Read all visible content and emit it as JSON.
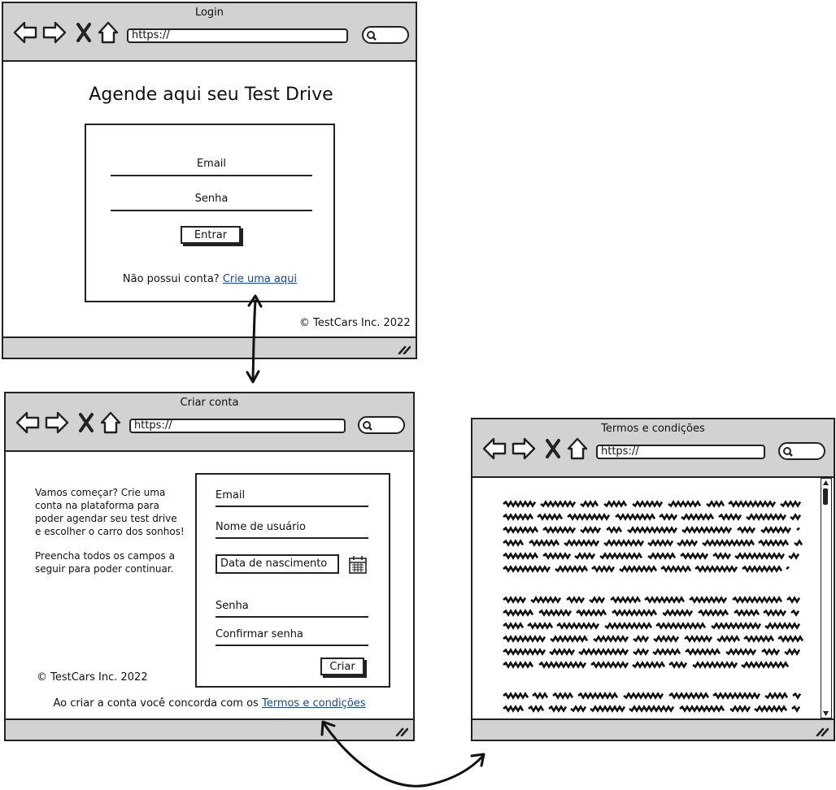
{
  "login": {
    "title": "Login",
    "url": "https://",
    "heading": "Agende aqui seu Test Drive",
    "email_label": "Email",
    "password_label": "Senha",
    "submit_label": "Entrar",
    "no_account": "Não possui conta?",
    "create_link": "Crie uma aqui",
    "footer": "© TestCars Inc. 2022"
  },
  "signup": {
    "title": "Criar conta",
    "url": "https://",
    "intro_lines": [
      "Vamos começar? Crie uma",
      "conta na plataforma para",
      "poder agendar seu test drive",
      "e escolher o carro dos sonhos!"
    ],
    "instruction_lines": [
      "Preencha todos os campos a",
      "seguir para poder continuar."
    ],
    "email_label": "Email",
    "username_label": "Nome de usuário",
    "birthdate_label": "Data de nascimento",
    "password_label": "Senha",
    "confirm_label": "Confirmar senha",
    "submit_label": "Criar",
    "footer": "© TestCars Inc. 2022",
    "terms_text": "Ao criar a conta você concorda com os",
    "terms_link": "Termos e condições"
  },
  "terms": {
    "title": "Termos e condições",
    "url": "https://"
  },
  "colors": {
    "chrome": "#d2d2d2",
    "link": "#1a4a8a",
    "stroke": "#222222"
  },
  "icons": [
    "back-arrow-icon",
    "forward-arrow-icon",
    "close-icon",
    "home-icon",
    "search-icon",
    "resize-grip-icon",
    "calendar-icon"
  ]
}
